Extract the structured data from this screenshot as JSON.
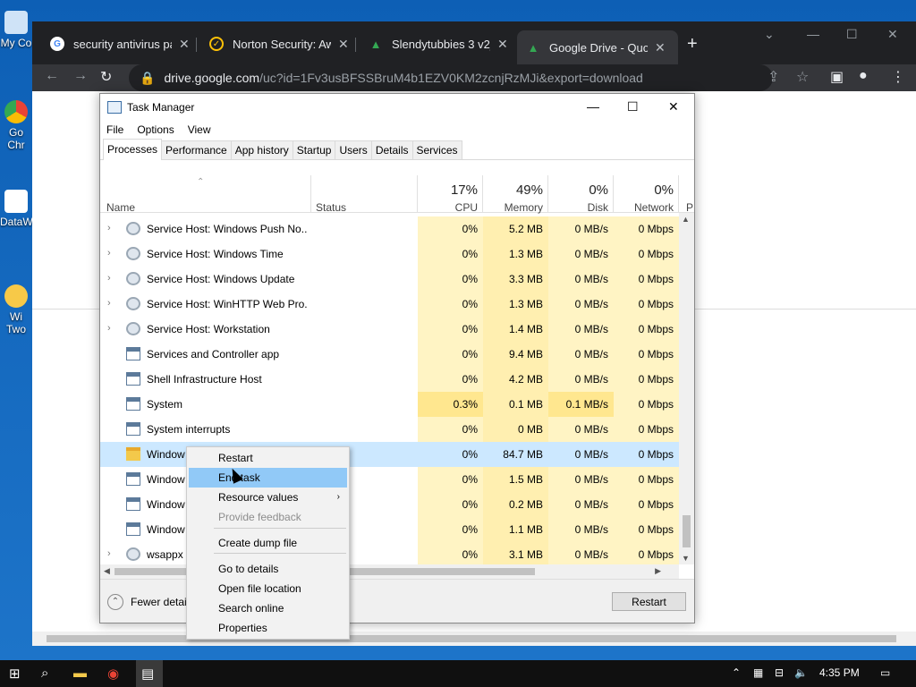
{
  "desktop": {
    "icons": [
      {
        "label": "My Co",
        "top": 0
      },
      {
        "label": "Go Chr",
        "top": 0
      },
      {
        "label": "DataW",
        "top": 0
      },
      {
        "label": "Wi Two",
        "top": 0
      }
    ]
  },
  "browser": {
    "tabs": [
      {
        "title": "security antivirus pay",
        "icon": "google-icon",
        "color": "#ffffff"
      },
      {
        "title": "Norton Security: Awa",
        "icon": "norton-icon",
        "color": "#ffc107"
      },
      {
        "title": "Slendytubbies 3 v2_3",
        "icon": "drive-icon",
        "color": "#34a853"
      },
      {
        "title": "Google Drive - Quota",
        "icon": "drive-icon",
        "color": "#34a853"
      }
    ],
    "url_host": "drive.google.com",
    "url_path": "/uc?id=1Fv3usBFSSBruM4b1EZV0KM2zcnjRzMJi&export=download"
  },
  "taskmanager": {
    "title": "Task Manager",
    "menu": [
      "File",
      "Options",
      "View"
    ],
    "tabs": [
      "Processes",
      "Performance",
      "App history",
      "Startup",
      "Users",
      "Details",
      "Services"
    ],
    "headers": {
      "name": "Name",
      "status": "Status",
      "cpu_pct": "17%",
      "cpu": "CPU",
      "mem_pct": "49%",
      "mem": "Memory",
      "disk_pct": "0%",
      "disk": "Disk",
      "net_pct": "0%",
      "net": "Network",
      "power": "P"
    },
    "rows": [
      {
        "name": "Service Host: Windows Push No...",
        "cpu": "0%",
        "mem": "5.2 MB",
        "disk": "0 MB/s",
        "net": "0 Mbps",
        "icon": "gear",
        "expand": true
      },
      {
        "name": "Service Host: Windows Time",
        "cpu": "0%",
        "mem": "1.3 MB",
        "disk": "0 MB/s",
        "net": "0 Mbps",
        "icon": "gear",
        "expand": true
      },
      {
        "name": "Service Host: Windows Update",
        "cpu": "0%",
        "mem": "3.3 MB",
        "disk": "0 MB/s",
        "net": "0 Mbps",
        "icon": "gear",
        "expand": true
      },
      {
        "name": "Service Host: WinHTTP Web Pro...",
        "cpu": "0%",
        "mem": "1.3 MB",
        "disk": "0 MB/s",
        "net": "0 Mbps",
        "icon": "gear",
        "expand": true
      },
      {
        "name": "Service Host: Workstation",
        "cpu": "0%",
        "mem": "1.4 MB",
        "disk": "0 MB/s",
        "net": "0 Mbps",
        "icon": "gear",
        "expand": true
      },
      {
        "name": "Services and Controller app",
        "cpu": "0%",
        "mem": "9.4 MB",
        "disk": "0 MB/s",
        "net": "0 Mbps",
        "icon": "app",
        "expand": false
      },
      {
        "name": "Shell Infrastructure Host",
        "cpu": "0%",
        "mem": "4.2 MB",
        "disk": "0 MB/s",
        "net": "0 Mbps",
        "icon": "app",
        "expand": false
      },
      {
        "name": "System",
        "cpu": "0.3%",
        "mem": "0.1 MB",
        "disk": "0.1 MB/s",
        "net": "0 Mbps",
        "icon": "app",
        "expand": false,
        "hi": true
      },
      {
        "name": "System interrupts",
        "cpu": "0%",
        "mem": "0 MB",
        "disk": "0 MB/s",
        "net": "0 Mbps",
        "icon": "app",
        "expand": false
      },
      {
        "name": "Window",
        "cpu": "0%",
        "mem": "84.7 MB",
        "disk": "0 MB/s",
        "net": "0 Mbps",
        "icon": "folder",
        "expand": false,
        "sel": true
      },
      {
        "name": "Window",
        "cpu": "0%",
        "mem": "1.5 MB",
        "disk": "0 MB/s",
        "net": "0 Mbps",
        "icon": "app",
        "expand": false
      },
      {
        "name": "Window",
        "cpu": "0%",
        "mem": "0.2 MB",
        "disk": "0 MB/s",
        "net": "0 Mbps",
        "icon": "app",
        "expand": false
      },
      {
        "name": "Window",
        "cpu": "0%",
        "mem": "1.1 MB",
        "disk": "0 MB/s",
        "net": "0 Mbps",
        "icon": "app",
        "expand": false
      },
      {
        "name": "wsappx",
        "cpu": "0%",
        "mem": "3.1 MB",
        "disk": "0 MB/s",
        "net": "0 Mbps",
        "icon": "gear",
        "expand": true
      }
    ],
    "fewer_details": "Fewer detail",
    "restart_button": "Restart"
  },
  "context_menu": {
    "items": [
      {
        "label": "Restart"
      },
      {
        "label": "End task",
        "hover": true
      },
      {
        "label": "Resource values",
        "submenu": true
      },
      {
        "label": "Provide feedback",
        "disabled": true
      },
      {
        "label": "Create dump file"
      },
      {
        "label": "Go to details"
      },
      {
        "label": "Open file location"
      },
      {
        "label": "Search online"
      },
      {
        "label": "Properties"
      }
    ]
  },
  "taskbar": {
    "clock": "4:35 PM"
  }
}
